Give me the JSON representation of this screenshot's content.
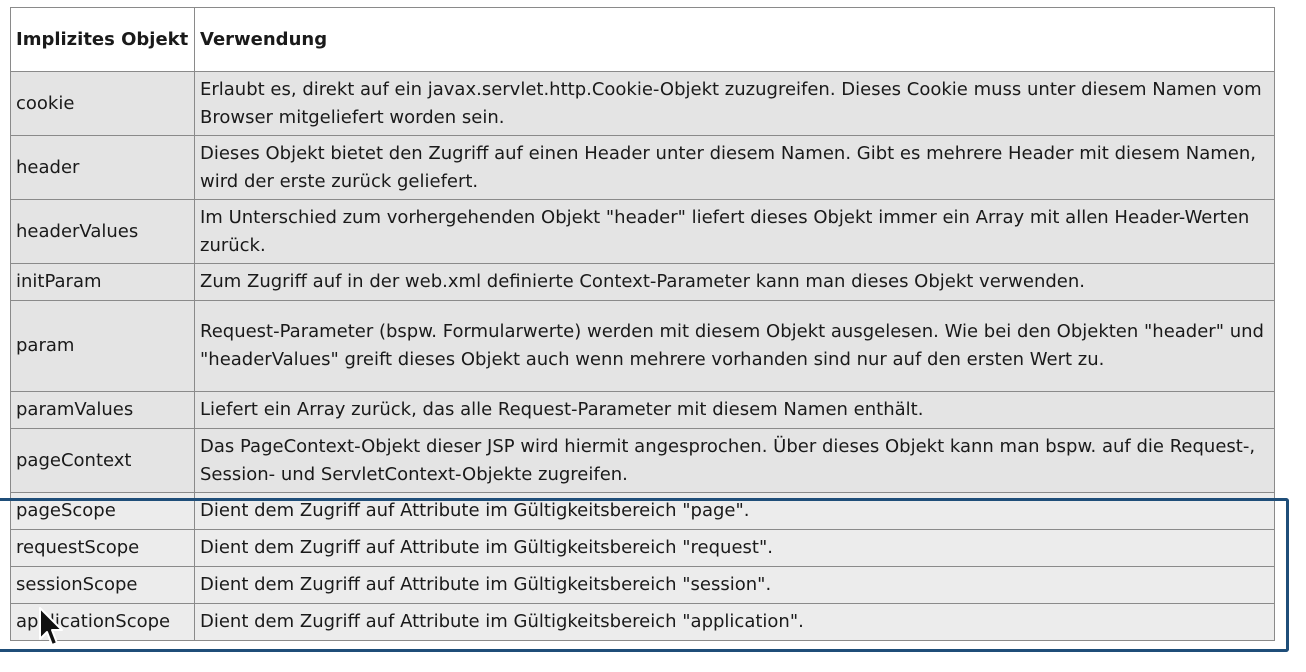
{
  "table": {
    "headers": [
      "Implizites Objekt",
      "Verwendung"
    ],
    "rows": [
      {
        "name": "cookie",
        "desc": "Erlaubt es, direkt auf ein javax.servlet.http.Cookie-Objekt zuzugreifen. Dieses Cookie muss unter diesem Namen vom Browser mitgeliefert worden sein."
      },
      {
        "name": "header",
        "desc": "Dieses Objekt bietet den Zugriff auf einen Header unter diesem Namen. Gibt es mehrere Header mit diesem Namen, wird der erste zurück geliefert."
      },
      {
        "name": "headerValues",
        "desc": "Im Unterschied zum vorhergehenden Objekt \"header\" liefert dieses Objekt immer ein Array mit allen Header-Werten zurück."
      },
      {
        "name": "initParam",
        "desc": "Zum Zugriff auf in der web.xml definierte Context-Parameter kann man dieses Objekt verwenden."
      },
      {
        "name": "param",
        "desc": "Request-Parameter (bspw. Formularwerte) werden mit diesem Objekt ausgelesen. Wie bei den Objekten \"header\" und \"headerValues\" greift dieses Objekt auch wenn mehrere vorhanden sind nur auf den ersten Wert zu."
      },
      {
        "name": "paramValues",
        "desc": "Liefert ein Array zurück, das alle Request-Parameter mit diesem Namen enthält."
      },
      {
        "name": "pageContext",
        "desc": "Das PageContext-Objekt dieser JSP wird hiermit angesprochen. Über dieses Objekt kann man bspw. auf die Request-, Session- und ServletContext-Objekte zugreifen."
      },
      {
        "name": "pageScope",
        "desc": "Dient dem Zugriff auf Attribute im Gültigkeitsbereich \"page\"."
      },
      {
        "name": "requestScope",
        "desc": "Dient dem Zugriff auf Attribute im Gültigkeitsbereich \"request\"."
      },
      {
        "name": "sessionScope",
        "desc": "Dient dem Zugriff auf Attribute im Gültigkeitsbereich \"session\"."
      },
      {
        "name": "applicationScope",
        "desc": "Dient dem Zugriff auf Attribute im Gültigkeitsbereich \"application\"."
      }
    ]
  },
  "highlight_color": "#1f4e79",
  "cursor_icon": "mouse-pointer-icon"
}
